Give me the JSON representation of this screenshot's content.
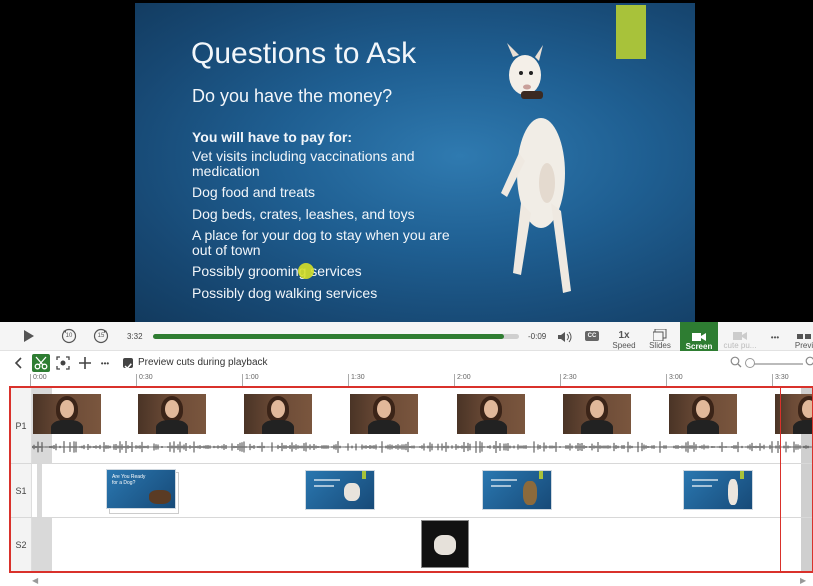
{
  "slide": {
    "title": "Questions to Ask",
    "subtitle": "Do you have the money?",
    "heading": "You will have to pay for:",
    "bullets": [
      "Vet visits including vaccinations and medication",
      "Dog food and treats",
      "Dog beds, crates, leashes, and toys",
      "A place for your dog to stay when you are out of town",
      "Possibly grooming services",
      "Possibly dog walking services"
    ],
    "accent_color": "#a8c23a"
  },
  "player": {
    "time_elapsed": "3:32",
    "time_remaining": "-0:09",
    "progress": 0.96,
    "speed_label": "1x",
    "speed_caption": "Speed",
    "slides_caption": "Slides",
    "screen_caption": "Screen",
    "faded_caption": "cute pu...",
    "more_label": "•••",
    "preview_caption": "Previ",
    "cc_label": "CC",
    "rewind_label": "10",
    "forward_label": "15"
  },
  "edit_toolbar": {
    "preview_cuts_label": "Preview cuts during playback",
    "preview_cuts_checked": true
  },
  "ruler": {
    "ticks": [
      "0:00",
      "0:30",
      "1:00",
      "1:30",
      "2:00",
      "2:30",
      "3:00",
      "3:30"
    ]
  },
  "tracks": {
    "p1_label": "P1",
    "s1_label": "S1",
    "s2_label": "S2",
    "s1_first_slide_text": "Are You Ready for a Dog?"
  },
  "colors": {
    "accent_green": "#2e7d32",
    "selection_red": "#d9312b"
  }
}
